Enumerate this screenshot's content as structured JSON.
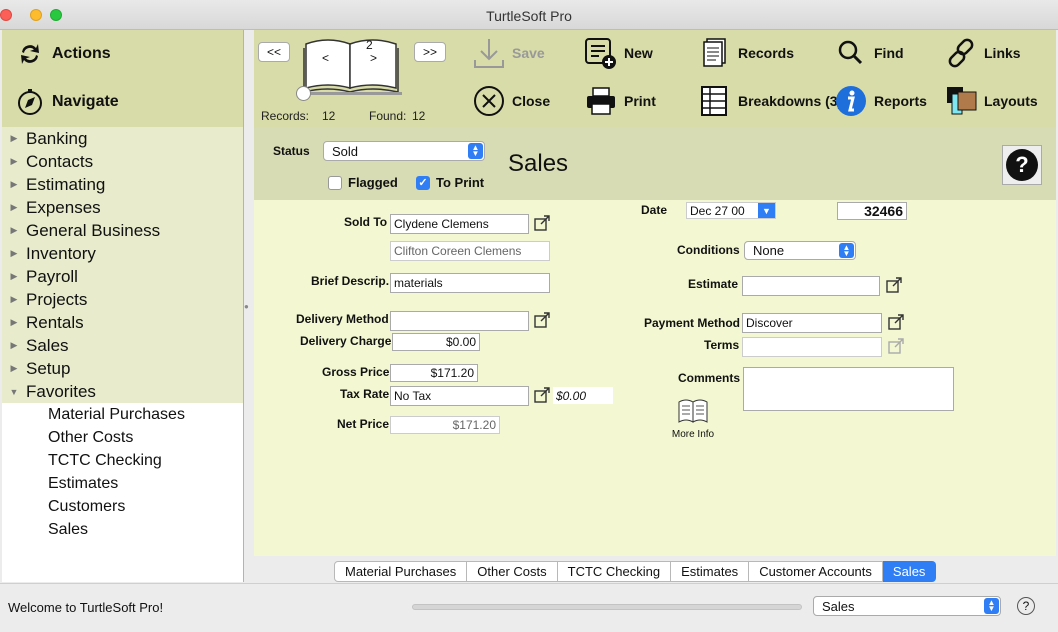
{
  "window": {
    "title": "TurtleSoft Pro"
  },
  "left_actions": {
    "actions": "Actions",
    "navigate": "Navigate"
  },
  "sidebar": {
    "items": [
      {
        "label": "Banking"
      },
      {
        "label": "Contacts"
      },
      {
        "label": "Estimating"
      },
      {
        "label": "Expenses"
      },
      {
        "label": "General Business"
      },
      {
        "label": "Inventory"
      },
      {
        "label": "Payroll"
      },
      {
        "label": "Projects"
      },
      {
        "label": "Rentals"
      },
      {
        "label": "Sales"
      },
      {
        "label": "Setup"
      },
      {
        "label": "Favorites"
      }
    ],
    "favorites": [
      {
        "label": "Material Purchases"
      },
      {
        "label": "Other Costs"
      },
      {
        "label": "TCTC Checking"
      },
      {
        "label": "Estimates"
      },
      {
        "label": "Customers"
      },
      {
        "label": "Sales"
      }
    ]
  },
  "toolbar": {
    "prev": "<<",
    "next": ">>",
    "book_page": "2",
    "book_left": "<",
    "book_right": ">",
    "records_label": "Records:",
    "records_value": "12",
    "found_label": "Found:",
    "found_value": "12",
    "save": "Save",
    "new": "New",
    "records": "Records",
    "find": "Find",
    "links": "Links",
    "close": "Close",
    "print": "Print",
    "breakdowns": "Breakdowns (3)",
    "reports": "Reports",
    "layouts": "Layouts"
  },
  "header": {
    "status_label": "Status",
    "status_value": "Sold",
    "flagged_label": "Flagged",
    "flagged_checked": false,
    "to_print_label": "To Print",
    "to_print_checked": true,
    "page_title": "Sales",
    "help": "?"
  },
  "form": {
    "sold_to_label": "Sold To",
    "sold_to_value": "Clydene Clemens",
    "sold_to_sub": "Clifton Coreen Clemens",
    "brief_descrip_label": "Brief Descrip.",
    "brief_descrip_value": "materials",
    "delivery_method_label": "Delivery Method",
    "delivery_method_value": "",
    "delivery_charge_label": "Delivery Charge",
    "delivery_charge_value": "$0.00",
    "gross_price_label": "Gross Price",
    "gross_price_value": "$171.20",
    "tax_rate_label": "Tax Rate",
    "tax_rate_value": "No Tax",
    "tax_amount": "$0.00",
    "net_price_label": "Net Price",
    "net_price_value": "$171.20",
    "date_label": "Date",
    "date_value": "Dec 27 00",
    "record_number": "32466",
    "conditions_label": "Conditions",
    "conditions_value": "None",
    "estimate_label": "Estimate",
    "estimate_value": "",
    "payment_method_label": "Payment Method",
    "payment_method_value": "Discover",
    "terms_label": "Terms",
    "terms_value": "",
    "comments_label": "Comments",
    "comments_value": "",
    "more_info": "More Info"
  },
  "tabs": [
    {
      "label": "Material Purchases"
    },
    {
      "label": "Other Costs"
    },
    {
      "label": "TCTC Checking"
    },
    {
      "label": "Estimates"
    },
    {
      "label": "Customer Accounts"
    },
    {
      "label": "Sales",
      "active": true
    }
  ],
  "statusbar": {
    "welcome": "Welcome to TurtleSoft Pro!",
    "layout_select": "Sales",
    "help": "?"
  },
  "colors": {
    "toolbar_bg": "#d8dca8",
    "form_bg": "#f3f7d2",
    "accent": "#2f7ef6"
  }
}
